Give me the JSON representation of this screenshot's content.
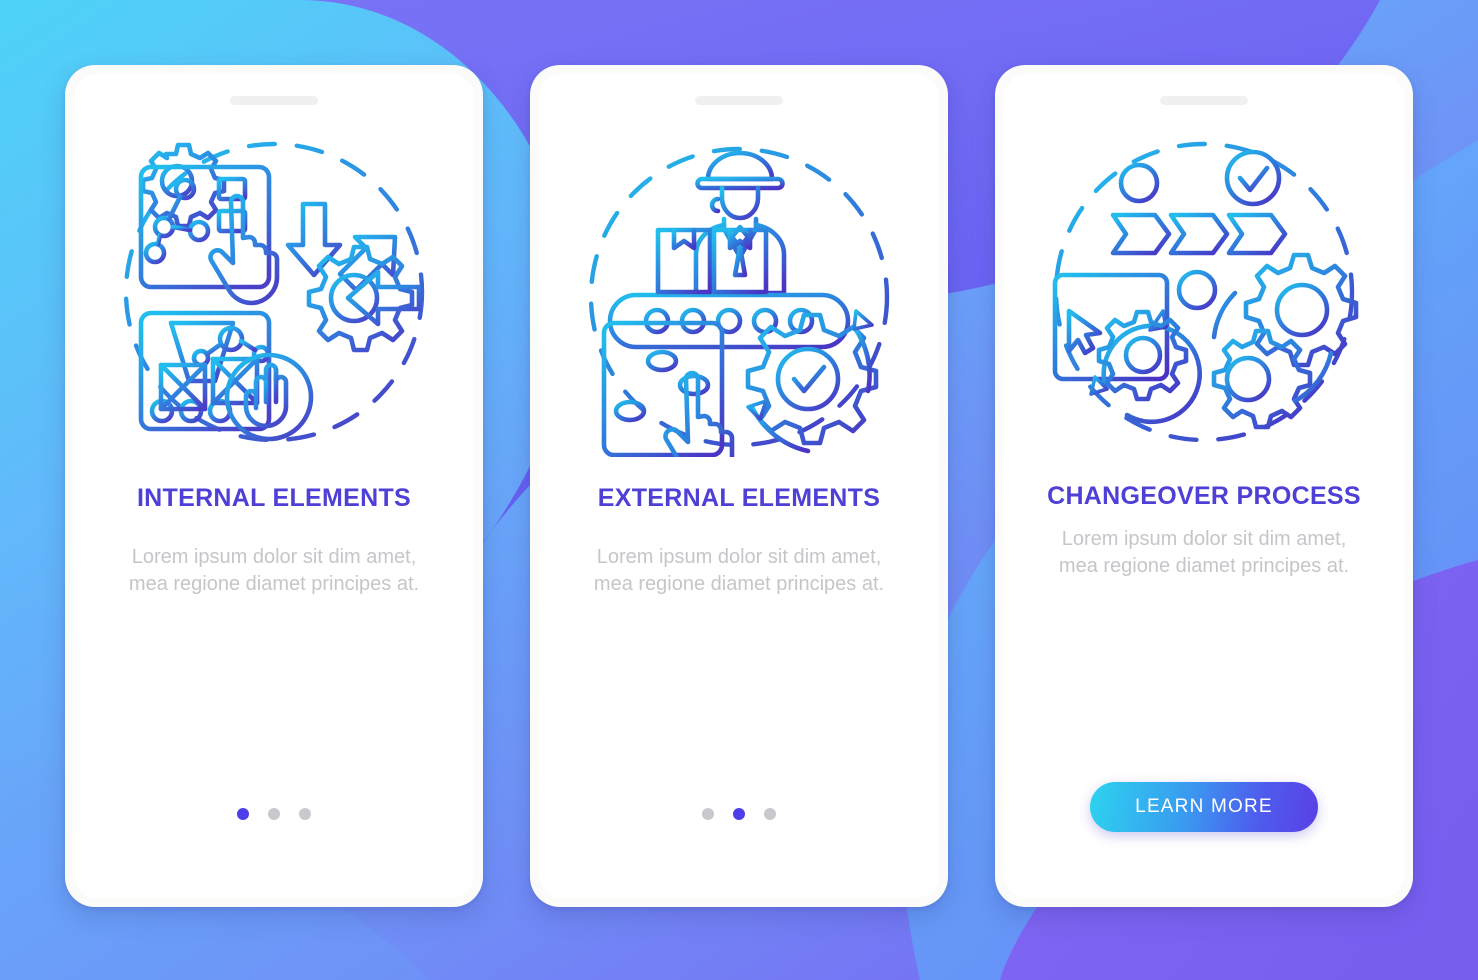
{
  "background": {
    "gradient_start": "#4ed3f7",
    "gradient_end": "#7a5cf0",
    "blob_purple": "#6f63f2",
    "blob_light_blue": "#5aa9fb"
  },
  "theme": {
    "title_color": "#4e3fd6",
    "body_color": "#c6c6ca",
    "dot_active_color": "#4d3ee8",
    "dot_inactive_color": "#c9c9cd",
    "illustration_gradient_start": "#22bdec",
    "illustration_gradient_end": "#4a3fc8",
    "button_gradient_start": "#2cd3ef",
    "button_gradient_end": "#5a3fe6",
    "phone_frame_color": "#fbfbfa",
    "screen_color": "#ffffff"
  },
  "screens": [
    {
      "id": "internal-elements",
      "title": "INTERNAL ELEMENTS",
      "body": "Lorem ipsum dolor sit dim amet, mea regione diamet principes at.",
      "illustration_name": "internal-elements-illustration",
      "illustration_elements": [
        "gear-icon",
        "control-panel-icon",
        "node-network-icon",
        "pointing-hand-icon",
        "down-arrow-icon",
        "diagonal-arrow-icon",
        "left-arrow-icon",
        "large-gear-icon",
        "conveyor-belt-icon",
        "robot-arm-icon",
        "box-icon",
        "stop-hand-icon",
        "dashed-circle-icon"
      ],
      "pagination": {
        "total": 3,
        "active": 1
      },
      "has_button": false
    },
    {
      "id": "external-elements",
      "title": "EXTERNAL ELEMENTS",
      "body": "Lorem ipsum dolor sit dim amet, mea regione diamet principes at.",
      "illustration_name": "external-elements-illustration",
      "illustration_elements": [
        "worker-hardhat-icon",
        "conveyor-belt-icon",
        "package-box-icon",
        "slider-panel-icon",
        "pointing-hand-icon",
        "gear-check-icon",
        "circular-arrows-icon",
        "dashed-circle-icon"
      ],
      "pagination": {
        "total": 3,
        "active": 2
      },
      "has_button": false
    },
    {
      "id": "changeover-process",
      "title": "CHANGEOVER PROCESS",
      "body": "Lorem ipsum dolor sit dim amet, mea regione diamet principes at.",
      "illustration_name": "changeover-process-illustration",
      "illustration_elements": [
        "browser-window-icon",
        "cursor-arrow-icon",
        "gear-refresh-icon",
        "gear-icon",
        "small-gear-icon",
        "flowchart-arrows-icon",
        "node-circle-icon",
        "check-circle-icon",
        "circular-arrows-icon",
        "dashed-circle-icon"
      ],
      "pagination": null,
      "has_button": true,
      "button_label": "LEARN MORE"
    }
  ]
}
